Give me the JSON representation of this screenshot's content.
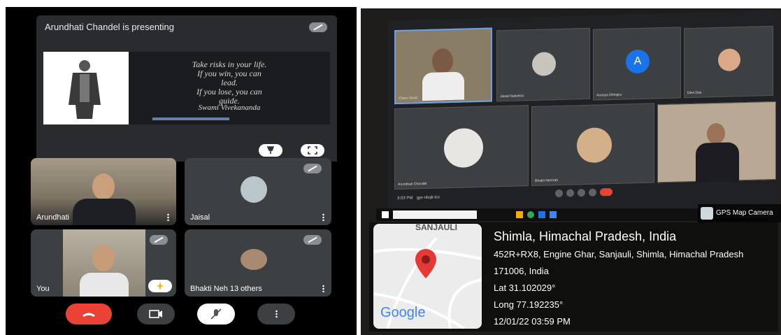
{
  "left_panel": {
    "presenting_text": "Arundhati Chandel is presenting",
    "slide": {
      "quote_lines": [
        "Take risks in your life.",
        "If you win, you can",
        "lead.",
        "If you lose, you can",
        "guide."
      ],
      "author": "Swami Vivekananda"
    },
    "tiles": [
      {
        "label": "Arundhati"
      },
      {
        "label": "Jaisal"
      },
      {
        "label": "You"
      },
      {
        "label": "Bhakti Neh 13 others"
      }
    ],
    "controls": {
      "end_call": "end-call-icon",
      "camera": "camera-icon",
      "mic": "mic-off-icon",
      "more": "more-options-icon"
    }
  },
  "right_panel": {
    "tiles": [
      {
        "name": "Charu Sood"
      },
      {
        "name": "Jaisal Nakshtra"
      },
      {
        "name": "Ananya Dhingra",
        "avatar_letter": "A"
      },
      {
        "name": "Devi Das"
      },
      {
        "name": "Arundhati Chandel"
      },
      {
        "name": "Bhakti Nemrah"
      },
      {
        "name": ""
      }
    ],
    "meet_bar_time": "3:03 PM",
    "meet_bar_code": "gpr-nbqk-tcc",
    "gps_app_label": "GPS Map Camera",
    "map": {
      "place_label": "SANJAULI",
      "provider": "Google"
    },
    "location": {
      "title": "Shimla, Himachal Pradesh, India",
      "address_line1": "452R+RX8, Engine Ghar, Sanjauli, Shimla, Himachal Pradesh",
      "address_line2": "171006, India",
      "lat": "Lat 31.102029°",
      "long": "Long 77.192235°",
      "datetime": "12/01/22 03:59 PM"
    },
    "colors": {
      "pin": "#e53935",
      "avatar_blue": "#1a73e8"
    }
  }
}
